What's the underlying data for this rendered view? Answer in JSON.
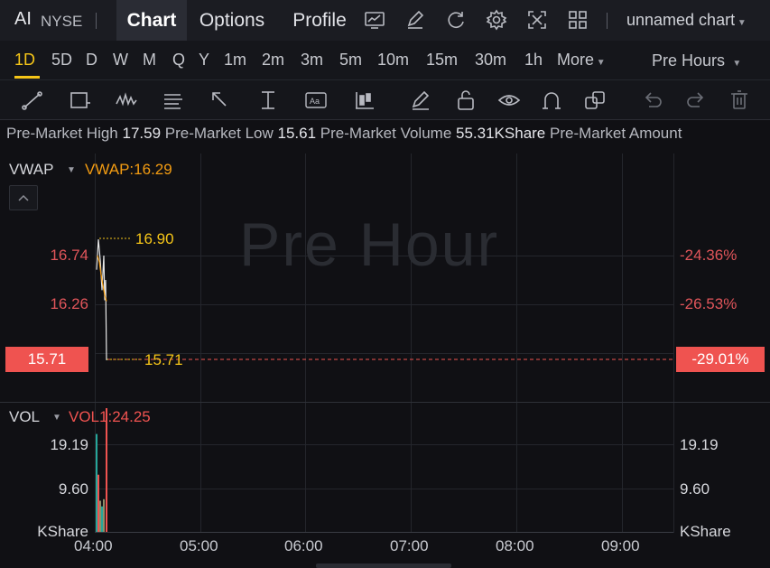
{
  "header": {
    "symbol": "AI",
    "exchange": "NYSE",
    "tabs": [
      "Chart",
      "Options",
      "Profile"
    ],
    "active_tab": "Chart",
    "chart_name": "unnamed chart",
    "icons": [
      "indicator-icon",
      "edit-icon",
      "refresh-icon",
      "settings-icon",
      "fullscreen-icon",
      "layout-grid-icon"
    ]
  },
  "timeframes": {
    "items": [
      "1D",
      "5D",
      "D",
      "W",
      "M",
      "Q",
      "Y",
      "1m",
      "2m",
      "3m",
      "5m",
      "10m",
      "15m",
      "30m",
      "1h",
      "More"
    ],
    "active": "1D",
    "session": "Pre Hours"
  },
  "toolbar": {
    "icons": [
      "trendline-icon",
      "rectangle-icon",
      "pattern-icon",
      "fib-icon",
      "arrow-icon",
      "measure-icon",
      "text-icon",
      "candles-icon",
      "pen-icon",
      "unlock-icon",
      "eye-icon",
      "magnet-icon",
      "copy-icon",
      "undo-icon",
      "redo-icon",
      "trash-icon"
    ]
  },
  "info": {
    "high_label": "Pre-Market High",
    "high_value": "17.59",
    "low_label": "Pre-Market Low",
    "low_value": "15.61",
    "volume_label": "Pre-Market Volume",
    "volume_value": "55.31KShare",
    "amount_label": "Pre-Market Amount"
  },
  "main_pane": {
    "indicator": "VWAP",
    "indicator_value": "VWAP:16.29",
    "watermark": "Pre Hour",
    "y_left": [
      "16.74",
      "16.26"
    ],
    "y_right": [
      "-24.36%",
      "-26.53%"
    ],
    "last_price": "15.71",
    "last_pct": "-29.01%",
    "high_marker": "16.90",
    "last_marker": "15.71",
    "colors": {
      "price_line": "#e8e8e8",
      "vwap": "#f39c12",
      "down": "#ef5350",
      "high_marker": "#f5c518"
    }
  },
  "volume_pane": {
    "indicator": "VOL",
    "indicator_value": "VOL1:24.25",
    "y_left": [
      "19.19",
      "9.60",
      "KShare"
    ],
    "y_right": [
      "19.19",
      "9.60",
      "KShare"
    ]
  },
  "time_axis": [
    "04:00",
    "05:00",
    "06:00",
    "07:00",
    "08:00",
    "09:00"
  ],
  "chart_data": {
    "type": "line",
    "title": "",
    "series": [
      {
        "name": "VWAP",
        "values": [
          16.74,
          16.68,
          16.55,
          16.45,
          16.35,
          16.29
        ]
      }
    ],
    "price_points": [
      16.6,
      16.9,
      16.7,
      16.4,
      16.74,
      16.3,
      16.5,
      15.71
    ],
    "volume": [
      19.19,
      11.2,
      6.1,
      5.0,
      6.4,
      24.25
    ],
    "ylim_price": [
      15.5,
      17.2
    ],
    "ylim_volume": [
      0,
      24.25
    ]
  }
}
